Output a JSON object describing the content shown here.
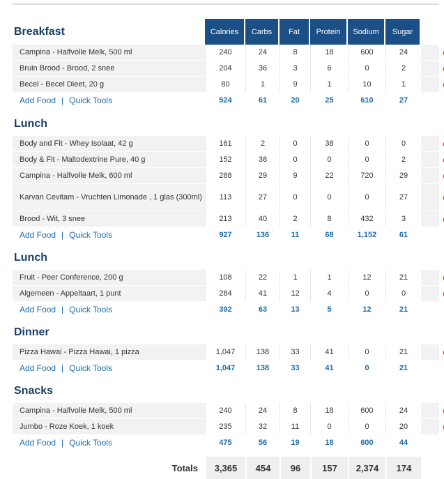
{
  "columns": [
    "Calories",
    "Carbs",
    "Fat",
    "Protein",
    "Sodium",
    "Sugar"
  ],
  "links": {
    "add_food": "Add Food",
    "separator": "|",
    "quick_tools": "Quick Tools"
  },
  "meals": [
    {
      "name": "Breakfast",
      "foods": [
        {
          "name": "Campina - Halfvolle Melk, 500 ml",
          "values": [
            "240",
            "24",
            "8",
            "18",
            "600",
            "24"
          ]
        },
        {
          "name": "Bruin Brood - Brood, 2 snee",
          "values": [
            "204",
            "36",
            "3",
            "6",
            "0",
            "2"
          ]
        },
        {
          "name": "Becel - Becel Dieet, 20 g",
          "values": [
            "80",
            "1",
            "9",
            "1",
            "10",
            "1"
          ]
        }
      ],
      "totals": [
        "524",
        "61",
        "20",
        "25",
        "610",
        "27"
      ]
    },
    {
      "name": "Lunch",
      "foods": [
        {
          "name": "Body and Fit - Whey Isolaat, 42 g",
          "values": [
            "161",
            "2",
            "0",
            "38",
            "0",
            "0"
          ]
        },
        {
          "name": "Body & Fit - Maltodextrine Pure, 40 g",
          "values": [
            "152",
            "38",
            "0",
            "0",
            "0",
            "2"
          ]
        },
        {
          "name": "Campina - Halfvolle Melk, 600 ml",
          "values": [
            "288",
            "29",
            "9",
            "22",
            "720",
            "29"
          ]
        },
        {
          "name": "Karvan Cevitam - Vruchten Limonade , 1 glas (300ml)",
          "values": [
            "113",
            "27",
            "0",
            "0",
            "0",
            "27"
          ]
        },
        {
          "name": "Brood - Wit, 3 snee",
          "values": [
            "213",
            "40",
            "2",
            "8",
            "432",
            "3"
          ]
        }
      ],
      "totals": [
        "927",
        "136",
        "11",
        "68",
        "1,152",
        "61"
      ]
    },
    {
      "name": "Lunch",
      "foods": [
        {
          "name": "Fruit - Peer Conference, 200 g",
          "values": [
            "108",
            "22",
            "1",
            "1",
            "12",
            "21"
          ]
        },
        {
          "name": "Algemeen - Appeltaart, 1 punt",
          "values": [
            "284",
            "41",
            "12",
            "4",
            "0",
            "0"
          ]
        }
      ],
      "totals": [
        "392",
        "63",
        "13",
        "5",
        "12",
        "21"
      ]
    },
    {
      "name": "Dinner",
      "foods": [
        {
          "name": "Pizza Hawai - Pizza Hawai, 1 pizza",
          "values": [
            "1,047",
            "138",
            "33",
            "41",
            "0",
            "21"
          ]
        }
      ],
      "totals": [
        "1,047",
        "138",
        "33",
        "41",
        "0",
        "21"
      ]
    },
    {
      "name": "Snacks",
      "foods": [
        {
          "name": "Campina - Halfvolle Melk, 500 ml",
          "values": [
            "240",
            "24",
            "8",
            "18",
            "600",
            "24"
          ]
        },
        {
          "name": "Jumbo - Roze Koek, 1 koek",
          "values": [
            "235",
            "32",
            "11",
            "0",
            "0",
            "20"
          ]
        }
      ],
      "totals": [
        "475",
        "56",
        "19",
        "18",
        "600",
        "44"
      ]
    }
  ],
  "grand_totals": {
    "label": "Totals",
    "values": [
      "3,365",
      "454",
      "96",
      "157",
      "2,374",
      "174"
    ]
  },
  "colors": {
    "header_bg": "#1b4f86",
    "link": "#1e6ba8",
    "remove_icon": "#d9141c"
  }
}
